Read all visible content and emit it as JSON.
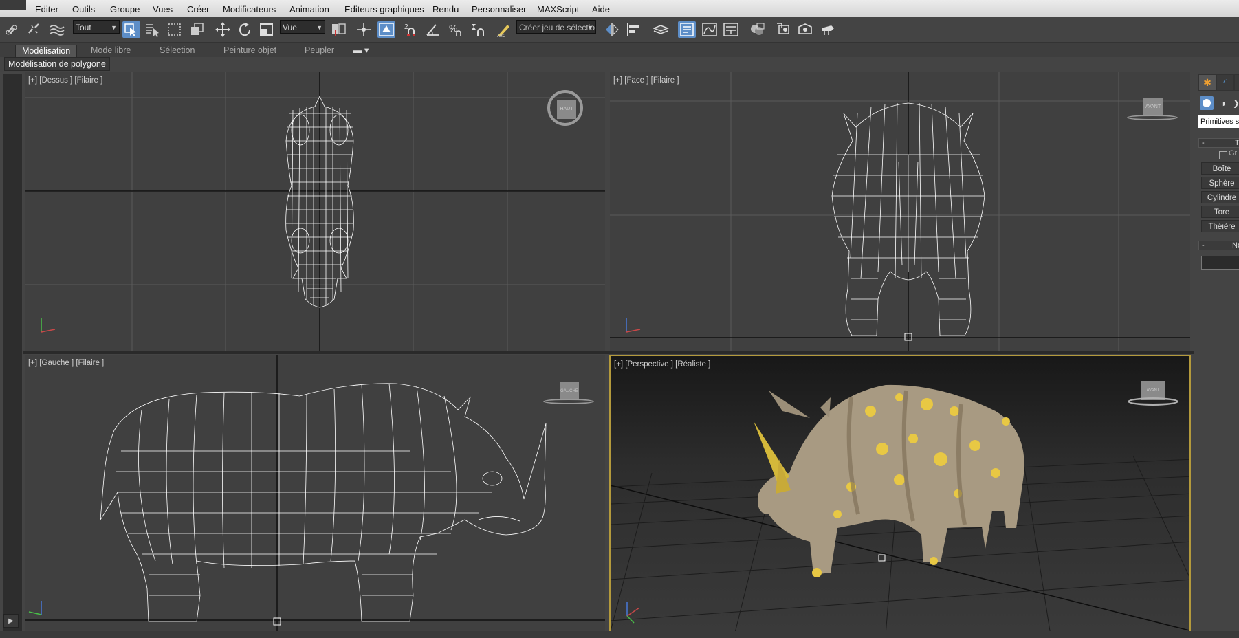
{
  "menu": [
    "Editer",
    "Outils",
    "Groupe",
    "Vues",
    "Créer",
    "Modificateurs",
    "Animation",
    "Editeurs graphiques",
    "Rendu",
    "Personnaliser",
    "MAXScript",
    "Aide"
  ],
  "toolbar": {
    "selection_filter": "Tout",
    "reference_coord": "Vue",
    "named_selection_placeholder": "Créer jeu de sélectio",
    "snap_label": "2",
    "snap_label2": "3"
  },
  "ribbon": {
    "tabs": [
      "Modélisation",
      "Mode libre",
      "Sélection",
      "Peinture objet",
      "Peupler"
    ],
    "sub_button": "Modélisation de polygone"
  },
  "viewports": {
    "top": "[+] [Dessus ] [Filaire ]",
    "front": "[+] [Face ] [Filaire ]",
    "left": "[+] [Gauche ] [Filaire ]",
    "persp": "[+] [Perspective ] [Réaliste ]"
  },
  "viewcube": {
    "top": "HAUT",
    "front": "AVANT",
    "left": "GAUCHE",
    "persp": "AVANT"
  },
  "command_panel": {
    "category": "Primitives st",
    "rollout_type": "Ty",
    "checkbox_label": "Gr",
    "buttons": [
      "Boîte",
      "Sphère",
      "Cylindre",
      "Tore",
      "Théière"
    ],
    "rollout_name": "Nor"
  },
  "colors": {
    "accent_active": "#5d8ec8",
    "persp_border": "#b49a3c",
    "wire": "#ffffff"
  }
}
